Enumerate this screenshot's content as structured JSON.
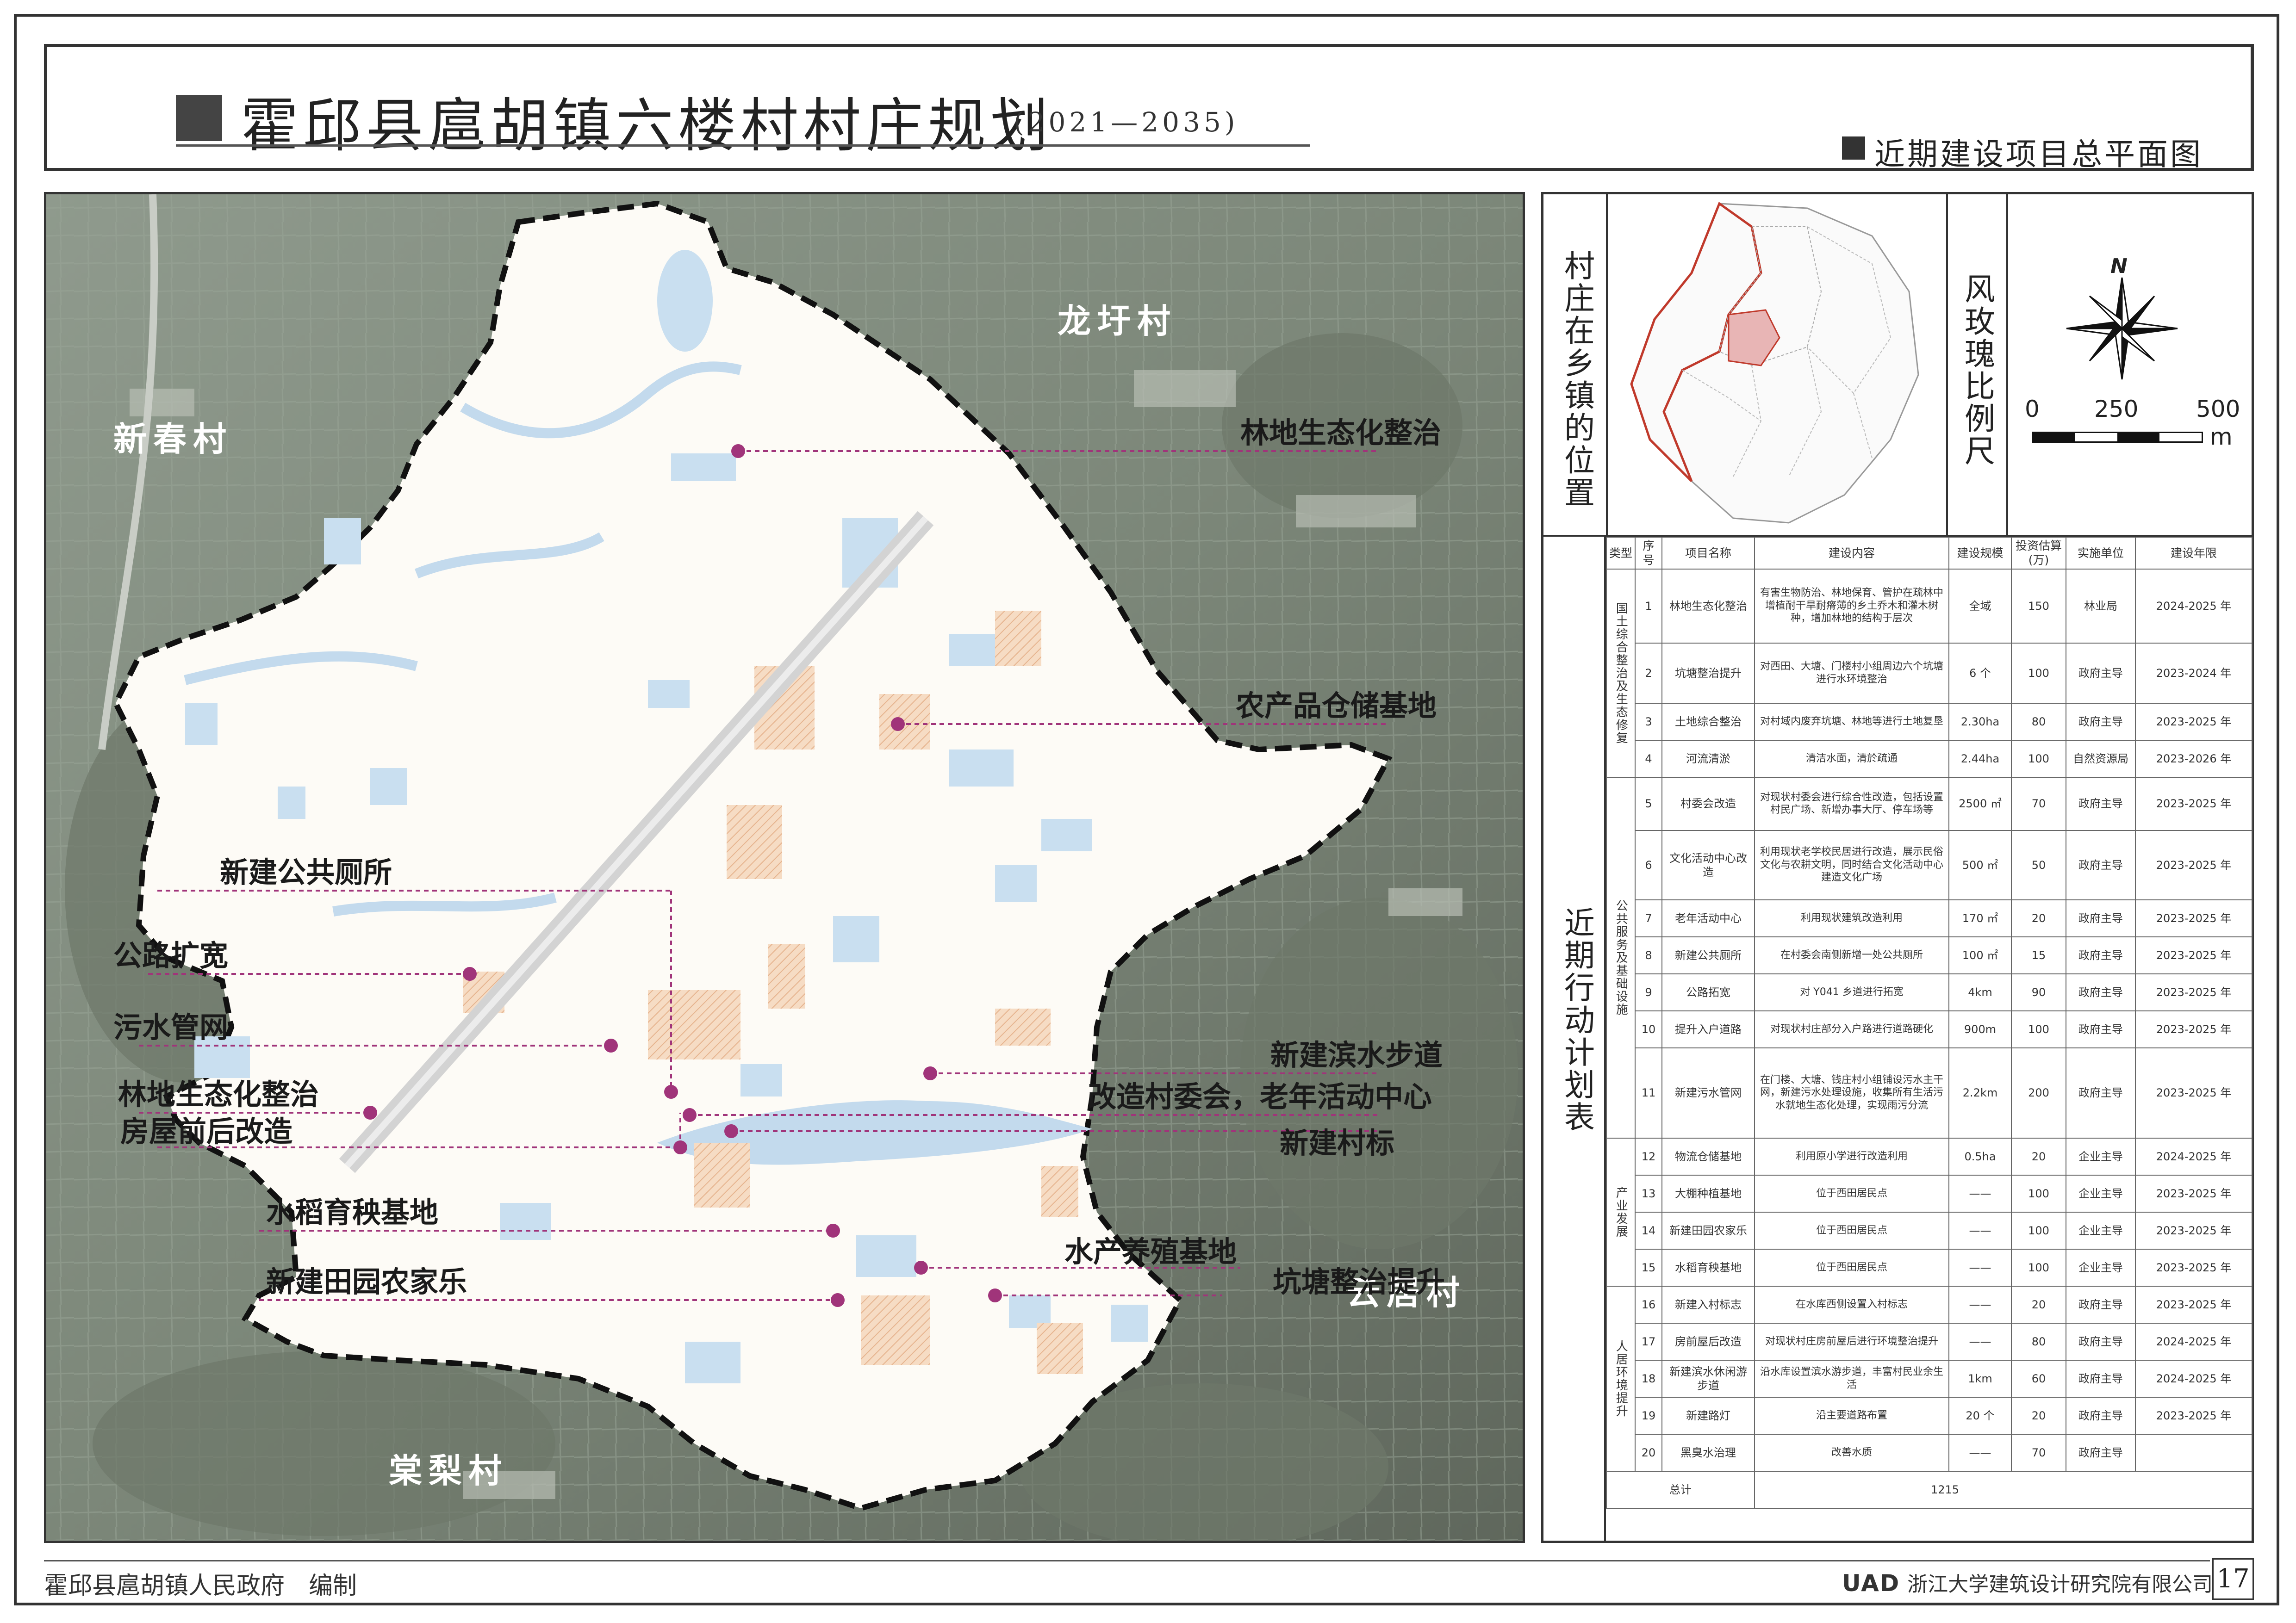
{
  "header": {
    "title": "霍邱县扈胡镇六楼村村庄规划",
    "years": "(2021—2035)",
    "subtitle": "近期建设项目总平面图"
  },
  "map": {
    "villages": [
      {
        "id": "longyu",
        "name": "龙圩村"
      },
      {
        "id": "xinchun",
        "name": "新春村"
      },
      {
        "id": "yunju",
        "name": "云居村"
      },
      {
        "id": "tangli",
        "name": "棠梨村"
      }
    ],
    "annotations": [
      {
        "id": "forest-ne",
        "label": "林地生态化整治"
      },
      {
        "id": "warehouse",
        "label": "农产品仓储基地"
      },
      {
        "id": "toilet",
        "label": "新建公共厕所"
      },
      {
        "id": "road",
        "label": "公路扩宽"
      },
      {
        "id": "sewer",
        "label": "污水管网"
      },
      {
        "id": "forest-w",
        "label": "林地生态化整治"
      },
      {
        "id": "house",
        "label": "房屋前后改造"
      },
      {
        "id": "rice",
        "label": "水稻育秧基地"
      },
      {
        "id": "farm",
        "label": "新建田园农家乐"
      },
      {
        "id": "waterfront",
        "label": "新建滨水步道"
      },
      {
        "id": "committee",
        "label": "改造村委会，老年活动中心"
      },
      {
        "id": "sign",
        "label": "新建村标"
      },
      {
        "id": "aqua",
        "label": "水产养殖基地"
      },
      {
        "id": "pond",
        "label": "坑塘整治提升"
      }
    ],
    "colors": {
      "boundary": "#1a1a1a",
      "leader": "#a0347a",
      "water": "#c9dff0",
      "land": "#fdfbf6"
    }
  },
  "sidebar": {
    "location_title": "村庄在乡镇的位置",
    "compass_title": "风玫瑰比例尺",
    "north": "N",
    "scale": {
      "ticks": [
        "0",
        "250",
        "500"
      ],
      "unit": "m"
    },
    "plan_title": "近期行动计划表"
  },
  "plan_table": {
    "headers": [
      "类型",
      "序号",
      "项目名称",
      "建设内容",
      "建设规模",
      "投资估算(万)",
      "实施单位",
      "建设年限"
    ],
    "categories": [
      {
        "name": "国土综合整治及生态修复",
        "rows": 4
      },
      {
        "name": "公共服务及基础设施",
        "rows": 7
      },
      {
        "name": "产业发展",
        "rows": 4
      },
      {
        "name": "人居环境提升",
        "rows": 5
      }
    ],
    "rows": [
      [
        "1",
        "林地生态化整治",
        "有害生物防治、林地保育、管护在疏林中增植耐干旱耐瘠薄的乡土乔木和灌木树种，增加林地的结构于层次",
        "全域",
        "150",
        "林业局",
        "2024-2025 年"
      ],
      [
        "2",
        "坑塘整治提升",
        "对西田、大塘、门楼村小组周边六个坑塘进行水环境整治",
        "6 个",
        "100",
        "政府主导",
        "2023-2024 年"
      ],
      [
        "3",
        "土地综合整治",
        "对村域内废弃坑塘、林地等进行土地复垦",
        "2.30ha",
        "80",
        "政府主导",
        "2023-2025 年"
      ],
      [
        "4",
        "河流清淤",
        "清洁水面，清於疏通",
        "2.44ha",
        "100",
        "自然资源局",
        "2023-2026 年"
      ],
      [
        "5",
        "村委会改造",
        "对现状村委会进行综合性改造，包括设置村民广场、新增办事大厅、停车场等",
        "2500 ㎡",
        "70",
        "政府主导",
        "2023-2025 年"
      ],
      [
        "6",
        "文化活动中心改造",
        "利用现状老学校民居进行改造，展示民俗文化与农耕文明，同时结合文化活动中心建造文化广场",
        "500 ㎡",
        "50",
        "政府主导",
        "2023-2025 年"
      ],
      [
        "7",
        "老年活动中心",
        "利用现状建筑改造利用",
        "170 ㎡",
        "20",
        "政府主导",
        "2023-2025 年"
      ],
      [
        "8",
        "新建公共厕所",
        "在村委会南侧新增一处公共厕所",
        "100 ㎡",
        "15",
        "政府主导",
        "2023-2025 年"
      ],
      [
        "9",
        "公路拓宽",
        "对 Y041 乡道进行拓宽",
        "4km",
        "90",
        "政府主导",
        "2023-2025 年"
      ],
      [
        "10",
        "提升入户道路",
        "对现状村庄部分入户路进行道路硬化",
        "900m",
        "100",
        "政府主导",
        "2023-2025 年"
      ],
      [
        "11",
        "新建污水管网",
        "在门楼、大塘、钱庄村小组铺设污水主干网，新建污水处理设施，收集所有生活污水就地生态化处理，实现雨污分流",
        "2.2km",
        "200",
        "政府主导",
        "2023-2025 年"
      ],
      [
        "12",
        "物流仓储基地",
        "利用原小学进行改造利用",
        "0.5ha",
        "20",
        "企业主导",
        "2024-2025 年"
      ],
      [
        "13",
        "大棚种植基地",
        "位于西田居民点",
        "——",
        "100",
        "企业主导",
        "2023-2025 年"
      ],
      [
        "14",
        "新建田园农家乐",
        "位于西田居民点",
        "——",
        "100",
        "企业主导",
        "2023-2025 年"
      ],
      [
        "15",
        "水稻育秧基地",
        "位于西田居民点",
        "——",
        "100",
        "企业主导",
        "2023-2025 年"
      ],
      [
        "16",
        "新建入村标志",
        "在水库西侧设置入村标志",
        "——",
        "20",
        "政府主导",
        "2023-2025 年"
      ],
      [
        "17",
        "房前屋后改造",
        "对现状村庄房前屋后进行环境整治提升",
        "——",
        "80",
        "政府主导",
        "2024-2025 年"
      ],
      [
        "18",
        "新建滨水休闲游步道",
        "沿水库设置滨水游步道，丰富村民业余生活",
        "1km",
        "60",
        "政府主导",
        "2024-2025 年"
      ],
      [
        "19",
        "新建路灯",
        "沿主要道路布置",
        "20 个",
        "20",
        "政府主导",
        "2023-2025 年"
      ],
      [
        "20",
        "黑臭水治理",
        "改善水质",
        "——",
        "70",
        "政府主导",
        ""
      ]
    ],
    "total_label": "总计",
    "total_value": "1215"
  },
  "footer": {
    "editor": "霍邱县扈胡镇人民政府　编制",
    "logo": "UAD",
    "institute": "浙江大学建筑设计研究院有限公司",
    "page": "17"
  }
}
